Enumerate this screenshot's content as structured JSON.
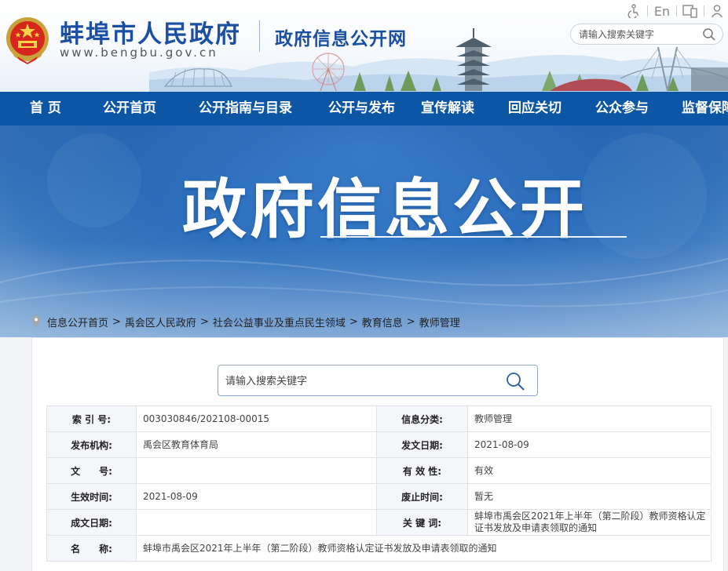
{
  "header": {
    "site_name": "蚌埠市人民政府",
    "site_url": "www.bengbu.gov.cn",
    "subsite_title": "政府信息公开网",
    "util": {
      "accessibility_label": "",
      "english_label": "En",
      "mobile_label": "",
      "user_label": ""
    },
    "search_placeholder": "请输入搜索关键字"
  },
  "nav": {
    "items": [
      {
        "label": "首 页"
      },
      {
        "label": "公开首页"
      },
      {
        "label": "公开指南与目录"
      },
      {
        "label": "公开与发布"
      },
      {
        "label": "宣传解读"
      },
      {
        "label": "回应关切"
      },
      {
        "label": "公众参与"
      },
      {
        "label": "监督保障"
      }
    ]
  },
  "banner": {
    "title": "政府信息公开"
  },
  "breadcrumb": {
    "items": [
      "信息公开首页",
      "禹会区人民政府",
      "社会公益事业及重点民生领域",
      "教育信息",
      "教师管理"
    ],
    "separator": ">"
  },
  "main_search": {
    "placeholder": "请输入搜索关键字"
  },
  "info": {
    "rows": [
      {
        "l1": "索 引 号:",
        "v1": "003030846/202108-00015",
        "l2": "信息分类:",
        "v2": "教师管理"
      },
      {
        "l1": "发布机构:",
        "v1": "禹会区教育体育局",
        "l2": "发文日期:",
        "v2": "2021-08-09"
      },
      {
        "l1": "文　　号:",
        "v1": "",
        "l2": "有 效 性:",
        "v2": "有效"
      },
      {
        "l1": "生效时间:",
        "v1": "2021-08-09",
        "l2": "废止时间:",
        "v2": "暂无"
      },
      {
        "l1": "成文日期:",
        "v1": "",
        "l2": "关 键 词:",
        "v2": "蚌埠市禹会区2021年上半年（第二阶段）教师资格认定证书发放及申请表领取的通知"
      }
    ],
    "name_label": "名　　称:",
    "name_value": "蚌埠市禹会区2021年上半年（第二阶段）教师资格认定证书发放及申请表领取的通知"
  },
  "colors": {
    "brand_blue": "#1a4fa3",
    "nav_blue": "#0d56a6",
    "banner_blue": "#2d70bd",
    "label_bg": "#f4f6f9"
  }
}
